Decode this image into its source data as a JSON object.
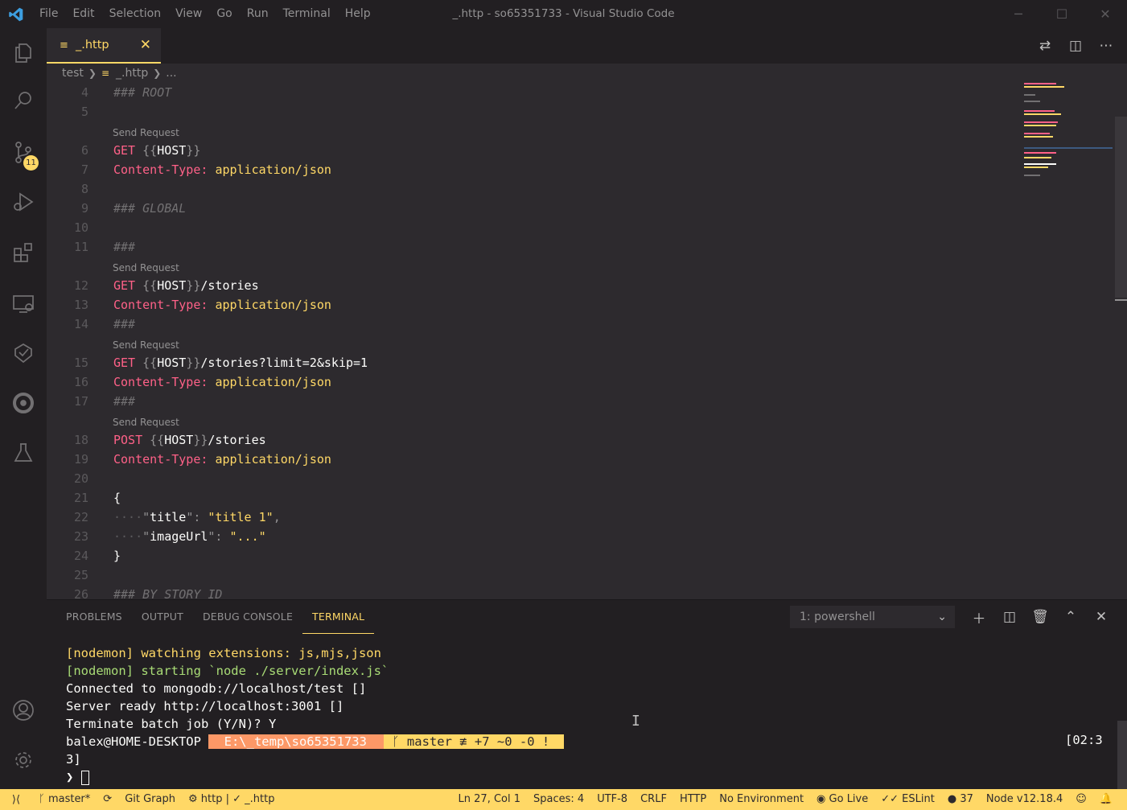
{
  "titlebar": {
    "menu": [
      "File",
      "Edit",
      "Selection",
      "View",
      "Go",
      "Run",
      "Terminal",
      "Help"
    ],
    "title": "_.http - so65351733 - Visual Studio Code"
  },
  "activitybar": {
    "icons": [
      "explorer-icon",
      "search-icon",
      "source-control-icon",
      "run-debug-icon",
      "extensions-icon",
      "remote-explorer-icon",
      "live-share-icon",
      "circleci-icon",
      "testing-icon",
      "accounts-icon",
      "settings-gear-icon"
    ],
    "scm_badge": "11"
  },
  "tab": {
    "label": "_.http"
  },
  "breadcrumb": {
    "folder": "test",
    "file": "_.http",
    "more": "..."
  },
  "editor": {
    "lens": "Send Request",
    "lines": {
      "l4": {
        "n": "4",
        "comment": "### ROOT"
      },
      "l5": {
        "n": "5"
      },
      "l6": {
        "n": "6",
        "method": "GET",
        "open": "{{",
        "var": "HOST",
        "close": "}}",
        "path": ""
      },
      "l7": {
        "n": "7",
        "key": "Content-Type:",
        "val": "application/json"
      },
      "l8": {
        "n": "8"
      },
      "l9": {
        "n": "9",
        "comment": "### GLOBAL"
      },
      "l10": {
        "n": "10"
      },
      "l11": {
        "n": "11",
        "comment": "###"
      },
      "l12": {
        "n": "12",
        "method": "GET",
        "open": "{{",
        "var": "HOST",
        "close": "}}",
        "path": "/stories"
      },
      "l13": {
        "n": "13",
        "key": "Content-Type:",
        "val": "application/json"
      },
      "l14": {
        "n": "14",
        "comment": "###"
      },
      "l15": {
        "n": "15",
        "method": "GET",
        "open": "{{",
        "var": "HOST",
        "close": "}}",
        "path": "/stories?limit=2&skip=1"
      },
      "l16": {
        "n": "16",
        "key": "Content-Type:",
        "val": "application/json"
      },
      "l17": {
        "n": "17",
        "comment": "###"
      },
      "l18": {
        "n": "18",
        "method": "POST",
        "open": "{{",
        "var": "HOST",
        "close": "}}",
        "path": "/stories"
      },
      "l19": {
        "n": "19",
        "key": "Content-Type:",
        "val": "application/json"
      },
      "l20": {
        "n": "20"
      },
      "l21": {
        "n": "21",
        "text": "{"
      },
      "l22": {
        "n": "22",
        "dots": "····",
        "q1": "\"",
        "k": "title",
        "q2": "\":",
        "v": "\"title 1\"",
        "comma": ","
      },
      "l23": {
        "n": "23",
        "dots": "····",
        "q1": "\"",
        "k": "imageUrl",
        "q2": "\":",
        "v": "\"...\"",
        "comma": ""
      },
      "l24": {
        "n": "24",
        "text": "}"
      },
      "l25": {
        "n": "25"
      },
      "l26": {
        "n": "26",
        "comment": "### BY STORY ID"
      }
    }
  },
  "panel": {
    "tabs": [
      "PROBLEMS",
      "OUTPUT",
      "DEBUG CONSOLE",
      "TERMINAL"
    ],
    "terminal_select": "1: powershell",
    "terminal": {
      "line1": "[nodemon] watching extensions: js,mjs,json",
      "line2": "[nodemon] starting `node ./server/index.js`",
      "line3": "Connected to mongodb://localhost/test []",
      "line4": "Server ready http://localhost:3001 []",
      "line5": "Terminate batch job (Y/N)? Y",
      "prompt_user": "balex@HOME-DESKTOP ",
      "prompt_path": " E:\\_temp\\so65351733 ",
      "prompt_git": "ᚴ master ≢ +7 ~0 -0 ! ",
      "time_a": "[02:3",
      "time_b": "3]",
      "prompt_char": "❯ "
    }
  },
  "statusbar": {
    "branch": "master*",
    "git_graph": "Git Graph",
    "http": "http | ✓ _.http",
    "position": "Ln 27, Col 1",
    "spaces": "Spaces: 4",
    "encoding": "UTF-8",
    "eol": "CRLF",
    "language": "HTTP",
    "environment": "No Environment",
    "go_live": "Go Live",
    "eslint": "ESLint",
    "github_count": "37",
    "node": "Node v12.18.4"
  },
  "colors": {
    "accent": "#ffd866",
    "background": "#2d2a2e",
    "sidebar": "#221f22",
    "pink": "#ff6188",
    "orange": "#fc9867",
    "green": "#a9dc76"
  }
}
